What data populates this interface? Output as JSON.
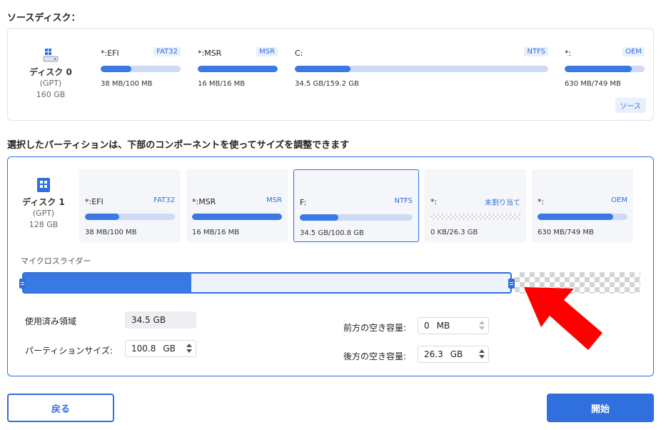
{
  "source_section": {
    "title": "ソースディスク：",
    "disk": {
      "name": "ディスク 0",
      "type": "(GPT)",
      "size": "160 GB"
    },
    "partitions": [
      {
        "name": "*:EFI",
        "fs": "FAT32",
        "size": "38 MB/100 MB",
        "used_fraction": 0.38
      },
      {
        "name": "*:MSR",
        "fs": "MSR",
        "size": "16 MB/16 MB",
        "used_fraction": 1.0
      },
      {
        "name": "C:",
        "fs": "NTFS",
        "size": "34.5 GB/159.2 GB",
        "used_fraction": 0.22
      },
      {
        "name": "*:",
        "fs": "OEM",
        "size": "630 MB/749 MB",
        "used_fraction": 0.84
      }
    ],
    "badge": "ソース"
  },
  "target_section": {
    "title": "選択したパーティションは、下部のコンポーネントを使ってサイズを調整できます",
    "disk": {
      "name": "ディスク 1",
      "type": "(GPT)",
      "size": "128 GB"
    },
    "partitions": [
      {
        "name": "*:EFI",
        "fs": "FAT32",
        "size": "38 MB/100 MB",
        "used_fraction": 0.38
      },
      {
        "name": "*:MSR",
        "fs": "MSR",
        "size": "16 MB/16 MB",
        "used_fraction": 1.0
      },
      {
        "name": "F:",
        "fs": "NTFS",
        "size": "34.5 GB/100.8 GB",
        "used_fraction": 0.34,
        "selected": true
      },
      {
        "name": "*:",
        "fs": "未割り当て",
        "size": "0 KB/26.3 GB",
        "used_fraction": 0,
        "unallocated": true
      },
      {
        "name": "*:",
        "fs": "OEM",
        "size": "630 MB/749 MB",
        "used_fraction": 0.84
      }
    ],
    "slider": {
      "label": "マイクロスライダー",
      "used_fraction": 0.345
    },
    "form": {
      "used_label": "使用済み領域",
      "used_value": "34.5 GB",
      "partition_size_label": "パーティションサイズ:",
      "partition_size_value": "100.8",
      "partition_size_unit": "GB",
      "free_before_label": "前方の空き容量:",
      "free_before_value": "0",
      "free_before_unit": "MB",
      "free_after_label": "後方の空き容量:",
      "free_after_value": "26.3",
      "free_after_unit": "GB"
    }
  },
  "buttons": {
    "back": "戻る",
    "start": "開始"
  },
  "colors": {
    "accent": "#2f6fde",
    "fill": "#3a78e4",
    "track": "#cfdbf4",
    "annotation_arrow": "#ff0000"
  }
}
